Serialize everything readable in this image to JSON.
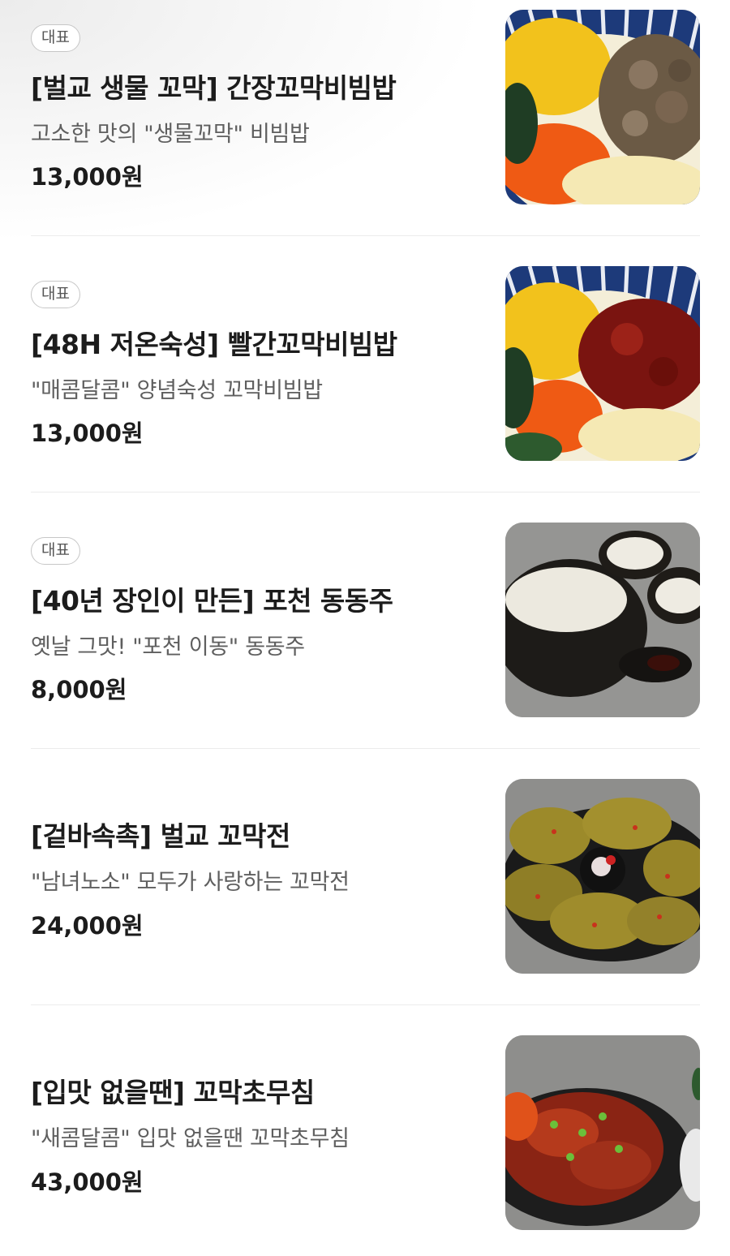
{
  "menu": {
    "items": [
      {
        "badge": "대표",
        "title": "[벌교 생물 꼬막] 간장꼬막비빔밥",
        "description": "고소한 맛의 \"생물꼬막\" 비빔밥",
        "price": "13,000원",
        "image_icon": "soy-cockle-bibimbap-photo"
      },
      {
        "badge": "대표",
        "title": "[48H 저온숙성] 빨간꼬막비빔밥",
        "description": "\"매콤달콤\" 양념숙성 꼬막비빔밥",
        "price": "13,000원",
        "image_icon": "spicy-cockle-bibimbap-photo"
      },
      {
        "badge": "대표",
        "title": "[40년 장인이 만든] 포천 동동주",
        "description": "옛날 그맛! \"포천 이동\" 동동주",
        "price": "8,000원",
        "image_icon": "dongdongju-photo"
      },
      {
        "badge": "",
        "title": "[겉바속촉] 벌교 꼬막전",
        "description": "\"남녀노소\" 모두가 사랑하는 꼬막전",
        "price": "24,000원",
        "image_icon": "cockle-pancake-photo"
      },
      {
        "badge": "",
        "title": "[입맛 없을땐] 꼬막초무침",
        "description": "\"새콤달콤\" 입맛 없을땐 꼬막초무침",
        "price": "43,000원",
        "image_icon": "cockle-salad-photo"
      }
    ]
  }
}
